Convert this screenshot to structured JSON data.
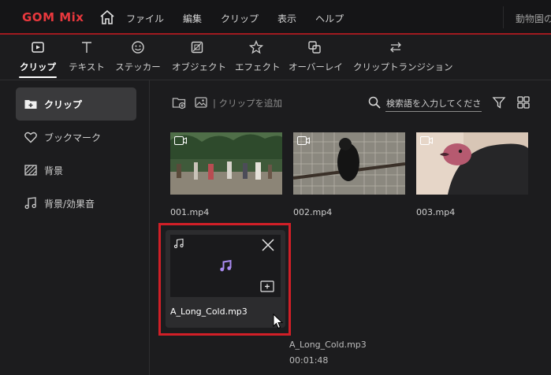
{
  "app": {
    "logo_gom": "GOM",
    "logo_mix": "Mix",
    "title_right": "動物園の"
  },
  "menu": [
    "ファイル",
    "編集",
    "クリップ",
    "表示",
    "ヘルプ"
  ],
  "tabs": [
    {
      "label": "クリップ",
      "icon": "clip-icon",
      "active": true
    },
    {
      "label": "テキスト",
      "icon": "text-icon"
    },
    {
      "label": "ステッカー",
      "icon": "sticker-icon"
    },
    {
      "label": "オブジェクト",
      "icon": "object-icon"
    },
    {
      "label": "エフェクト",
      "icon": "effect-icon"
    },
    {
      "label": "オーバーレイ",
      "icon": "overlay-icon"
    },
    {
      "label": "クリップトランジション",
      "icon": "transition-icon"
    }
  ],
  "sidebar": {
    "items": [
      {
        "label": "クリップ",
        "icon": "add-folder-icon",
        "active": true
      },
      {
        "label": "ブックマーク",
        "icon": "heart-icon"
      },
      {
        "label": "背景",
        "icon": "background-icon"
      },
      {
        "label": "背景/効果音",
        "icon": "music-note-icon"
      }
    ]
  },
  "main": {
    "add_clip_label": "| クリップを追加",
    "search_placeholder": "検索語を入力してください。",
    "clips": [
      {
        "name": "001.mp4",
        "type": "video"
      },
      {
        "name": "002.mp4",
        "type": "video"
      },
      {
        "name": "003.mp4",
        "type": "video"
      }
    ],
    "audio_clip": {
      "name": "A_Long_Cold.mp3",
      "type": "audio"
    },
    "drag_preview": {
      "name": "A_Long_Cold.mp3",
      "duration": "00:01:48"
    }
  },
  "colors": {
    "accent": "#e8383d",
    "highlight_box": "#d11f27",
    "audio_note": "#a98bf0"
  }
}
